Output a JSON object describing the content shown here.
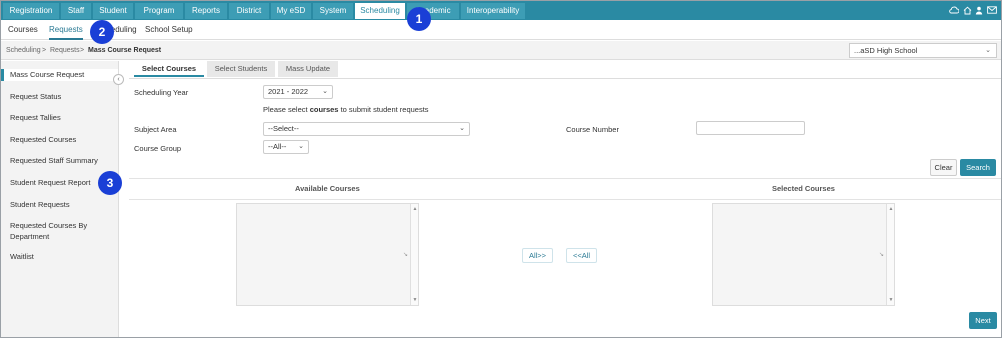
{
  "topnav": {
    "tabs": [
      "Registration",
      "Staff",
      "Student",
      "Program",
      "Reports",
      "District",
      "My eSD",
      "System",
      "Scheduling",
      "Academic",
      "Interoperability"
    ],
    "active": "Scheduling",
    "right_icons": [
      "cloud-icon",
      "home-icon",
      "user-icon",
      "mail-icon"
    ]
  },
  "subnav": {
    "items": [
      "Courses",
      "Requests",
      "Scheduling",
      "School Setup"
    ],
    "active": "Requests"
  },
  "breadcrumb": {
    "items": [
      "Scheduling",
      "Requests",
      "Mass Course Request"
    ],
    "separator": ">"
  },
  "school_selector": {
    "value": "...aSD High School"
  },
  "sidebar": {
    "items": [
      "Mass Course Request",
      "Request Status",
      "Request Tallies",
      "Requested Courses",
      "Requested Staff Summary",
      "Student Request Report",
      "Student Requests",
      "Requested Courses By",
      "Department",
      "Waitlist"
    ],
    "collapse_glyph": "‹"
  },
  "content_tabs": {
    "items": [
      "Select Courses",
      "Select Students",
      "Mass Update"
    ],
    "active": "Select Courses"
  },
  "form": {
    "scheduling_year_label": "Scheduling Year",
    "scheduling_year_value": "2021 - 2022",
    "instruction_prefix": "Please select",
    "instruction_bold": "courses",
    "instruction_suffix": "to submit student requests",
    "subject_area_label": "Subject Area",
    "subject_area_value": "--Select--",
    "course_number_label": "Course Number",
    "course_number_value": "",
    "course_group_label": "Course Group",
    "course_group_value": "--All--"
  },
  "buttons": {
    "clear": "Clear",
    "search": "Search",
    "add_all": "All>>",
    "remove_all": "<<All",
    "next": "Next"
  },
  "lists": {
    "available_title": "Available Courses",
    "selected_title": "Selected Courses"
  },
  "callouts": [
    "1",
    "2",
    "3"
  ],
  "colors": {
    "nav_bg": "#2a8aa3",
    "accent": "#2a7a94",
    "callout": "#1a3fd6"
  }
}
